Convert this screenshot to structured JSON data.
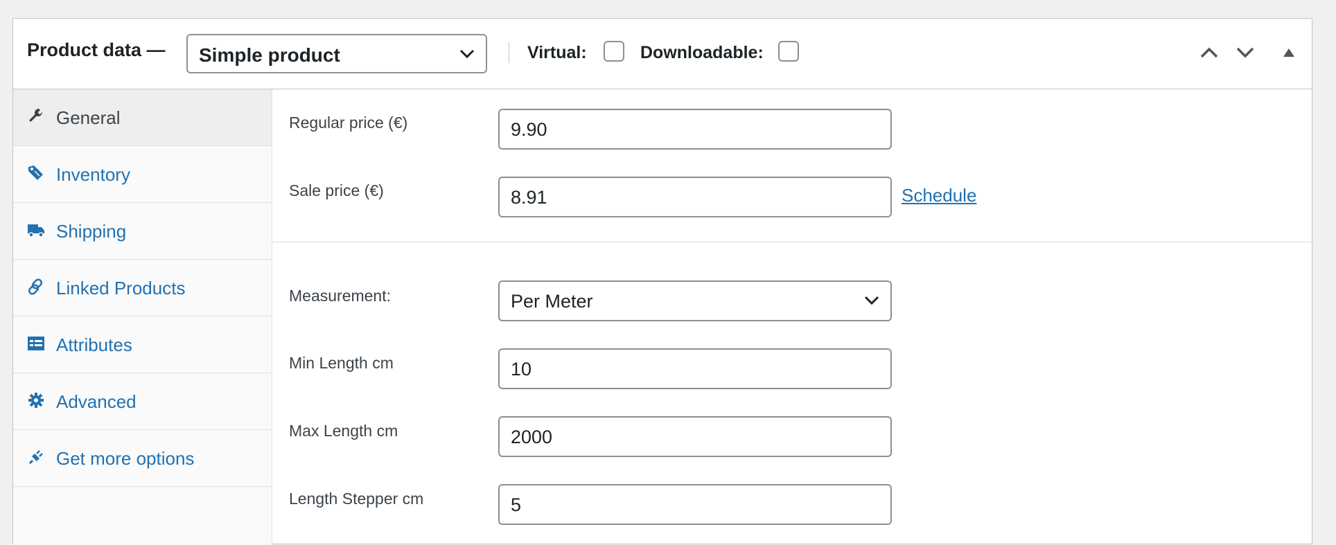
{
  "header": {
    "title": "Product data —",
    "product_type": "Simple product",
    "virtual_label": "Virtual:",
    "virtual_checked": false,
    "downloadable_label": "Downloadable:",
    "downloadable_checked": false
  },
  "tabs": [
    {
      "label": "General",
      "icon": "wrench-icon",
      "active": true
    },
    {
      "label": "Inventory",
      "icon": "tag-icon",
      "active": false
    },
    {
      "label": "Shipping",
      "icon": "truck-icon",
      "active": false
    },
    {
      "label": "Linked Products",
      "icon": "link-icon",
      "active": false
    },
    {
      "label": "Attributes",
      "icon": "list-card-icon",
      "active": false
    },
    {
      "label": "Advanced",
      "icon": "gear-icon",
      "active": false
    },
    {
      "label": "Get more options",
      "icon": "plugin-icon",
      "active": false
    }
  ],
  "general": {
    "regular_price": {
      "label": "Regular price (€)",
      "value": "9.90"
    },
    "sale_price": {
      "label": "Sale price (€)",
      "value": "8.91"
    },
    "schedule_link": "Schedule",
    "measurement": {
      "label": "Measurement:",
      "value": "Per Meter"
    },
    "min_length": {
      "label": "Min Length cm",
      "value": "10"
    },
    "max_length": {
      "label": "Max Length cm",
      "value": "2000"
    },
    "length_stepper": {
      "label": "Length Stepper cm",
      "value": "5"
    }
  },
  "colors": {
    "link": "#2271b1",
    "text": "#1d2327",
    "border": "#c3c4c7",
    "active_tab_bg": "#eeeeee"
  }
}
